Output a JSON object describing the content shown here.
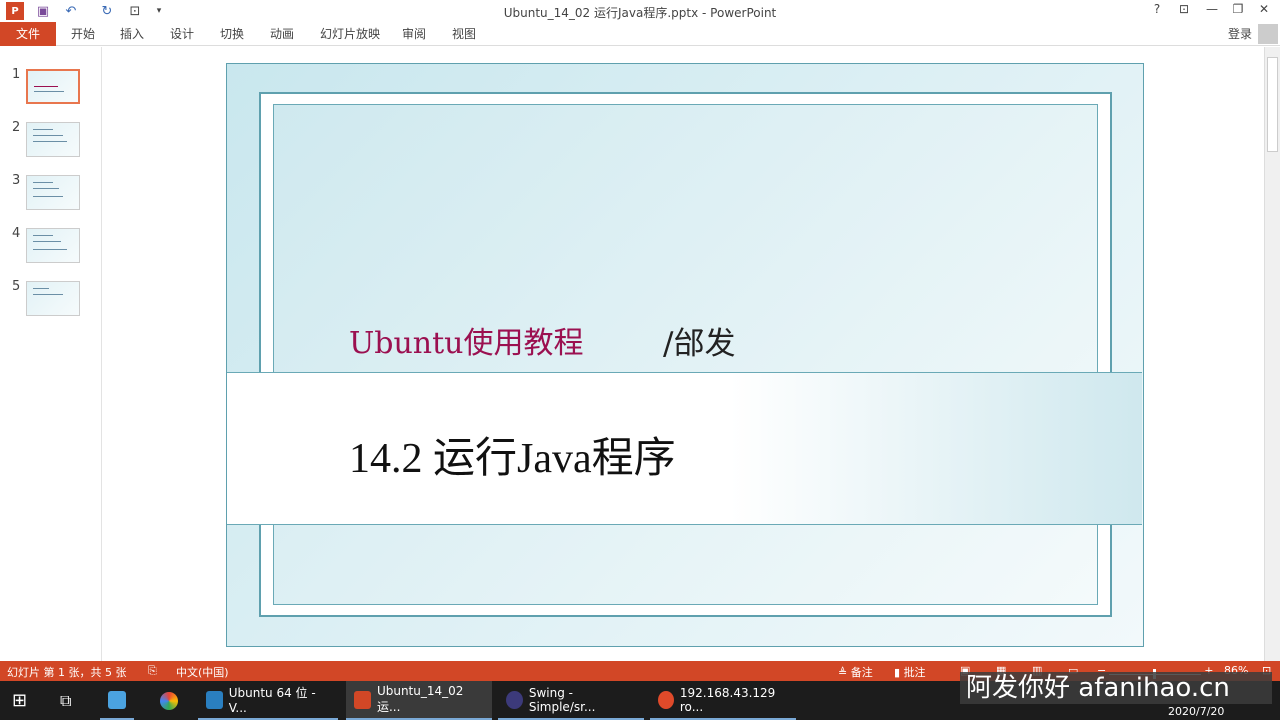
{
  "window": {
    "title": "Ubuntu_14_02 运行Java程序.pptx - PowerPoint",
    "help": "?",
    "controls": [
      "restore-ribbon",
      "minimize",
      "maximize",
      "close"
    ],
    "signin": "登录"
  },
  "ribbon": {
    "file": "文件",
    "tabs": [
      "开始",
      "插入",
      "设计",
      "切换",
      "动画",
      "幻灯片放映",
      "审阅",
      "视图"
    ]
  },
  "thumbnails": [
    {
      "n": "1"
    },
    {
      "n": "2"
    },
    {
      "n": "3"
    },
    {
      "n": "4"
    },
    {
      "n": "5"
    }
  ],
  "slide": {
    "subtitle": "Ubuntu使用教程",
    "author": "/邰发",
    "title": "14.2 运行Java程序"
  },
  "status": {
    "slide_info": "幻灯片 第 1 张，共 5 张",
    "language": "中文(中国)",
    "notes": "备注",
    "comments": "批注",
    "zoom": "86%",
    "zoom_level": 86
  },
  "taskbar": {
    "apps": [
      "Ubuntu 64 位 - V...",
      "Ubuntu_14_02 运...",
      "Swing - Simple/sr...",
      "192.168.43.129 ro..."
    ],
    "date": "2020/7/20"
  },
  "watermark": "阿发你好 afanihao.cn",
  "colors": {
    "accent": "#d24726",
    "subtitle": "#9b1050"
  }
}
